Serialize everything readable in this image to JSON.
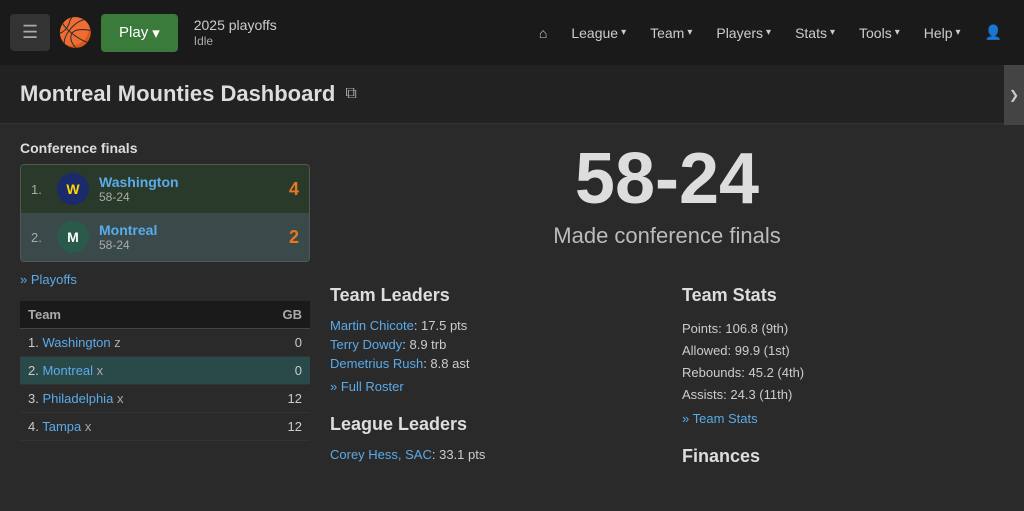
{
  "navbar": {
    "hamburger_label": "☰",
    "basketball_icon": "🏀",
    "play_label": "Play",
    "season_title": "2025 playoffs",
    "season_subtitle": "Idle",
    "home_icon": "⌂",
    "links": [
      {
        "label": "League",
        "has_arrow": true
      },
      {
        "label": "Team",
        "has_arrow": true
      },
      {
        "label": "Players",
        "has_arrow": true
      },
      {
        "label": "Stats",
        "has_arrow": true
      },
      {
        "label": "Tools",
        "has_arrow": true
      },
      {
        "label": "Help",
        "has_arrow": true
      }
    ],
    "user_icon": "👤"
  },
  "page": {
    "title": "Montreal Mounties Dashboard",
    "external_icon": "⧉"
  },
  "conference": {
    "section_title": "Conference finals",
    "teams": [
      {
        "rank": "1.",
        "name": "Washington",
        "record": "58-24",
        "score": "4",
        "logo_initials": "W"
      },
      {
        "rank": "2.",
        "name": "Montreal",
        "record": "58-24",
        "score": "2",
        "logo_initials": "M"
      }
    ],
    "playoffs_link": "» Playoffs"
  },
  "standings": {
    "headers": [
      "Team",
      "GB"
    ],
    "rows": [
      {
        "rank": "1.",
        "name": "Washington",
        "suffix": "z",
        "gb": "0",
        "highlight": false
      },
      {
        "rank": "2.",
        "name": "Montreal",
        "suffix": "x",
        "gb": "0",
        "highlight": true
      },
      {
        "rank": "3.",
        "name": "Philadelphia",
        "suffix": "x",
        "gb": "12",
        "highlight": false
      },
      {
        "rank": "4.",
        "name": "Tampa",
        "suffix": "x",
        "gb": "12",
        "highlight": false
      }
    ]
  },
  "big_record": {
    "record": "58-24",
    "subtitle": "Made conference finals"
  },
  "team_leaders": {
    "heading": "Team Leaders",
    "leaders": [
      {
        "name": "Martin Chicote",
        "stat": ": 17.5 pts"
      },
      {
        "name": "Terry Dowdy",
        "stat": ": 8.9 trb"
      },
      {
        "name": "Demetrius Rush",
        "stat": ": 8.8 ast"
      }
    ],
    "full_roster_link": "» Full Roster"
  },
  "team_stats": {
    "heading": "Team Stats",
    "stats": [
      "Points: 106.8 (9th)",
      "Allowed: 99.9 (1st)",
      "Rebounds: 45.2 (4th)",
      "Assists: 24.3 (11th)"
    ],
    "link": "» Team Stats"
  },
  "league_leaders": {
    "heading": "League Leaders",
    "leaders": [
      {
        "name": "Corey Hess, SAC",
        "stat": ": 33.1 pts"
      }
    ]
  },
  "finances": {
    "heading": "Finances"
  },
  "sidebar_toggle": {
    "label": "❯"
  }
}
